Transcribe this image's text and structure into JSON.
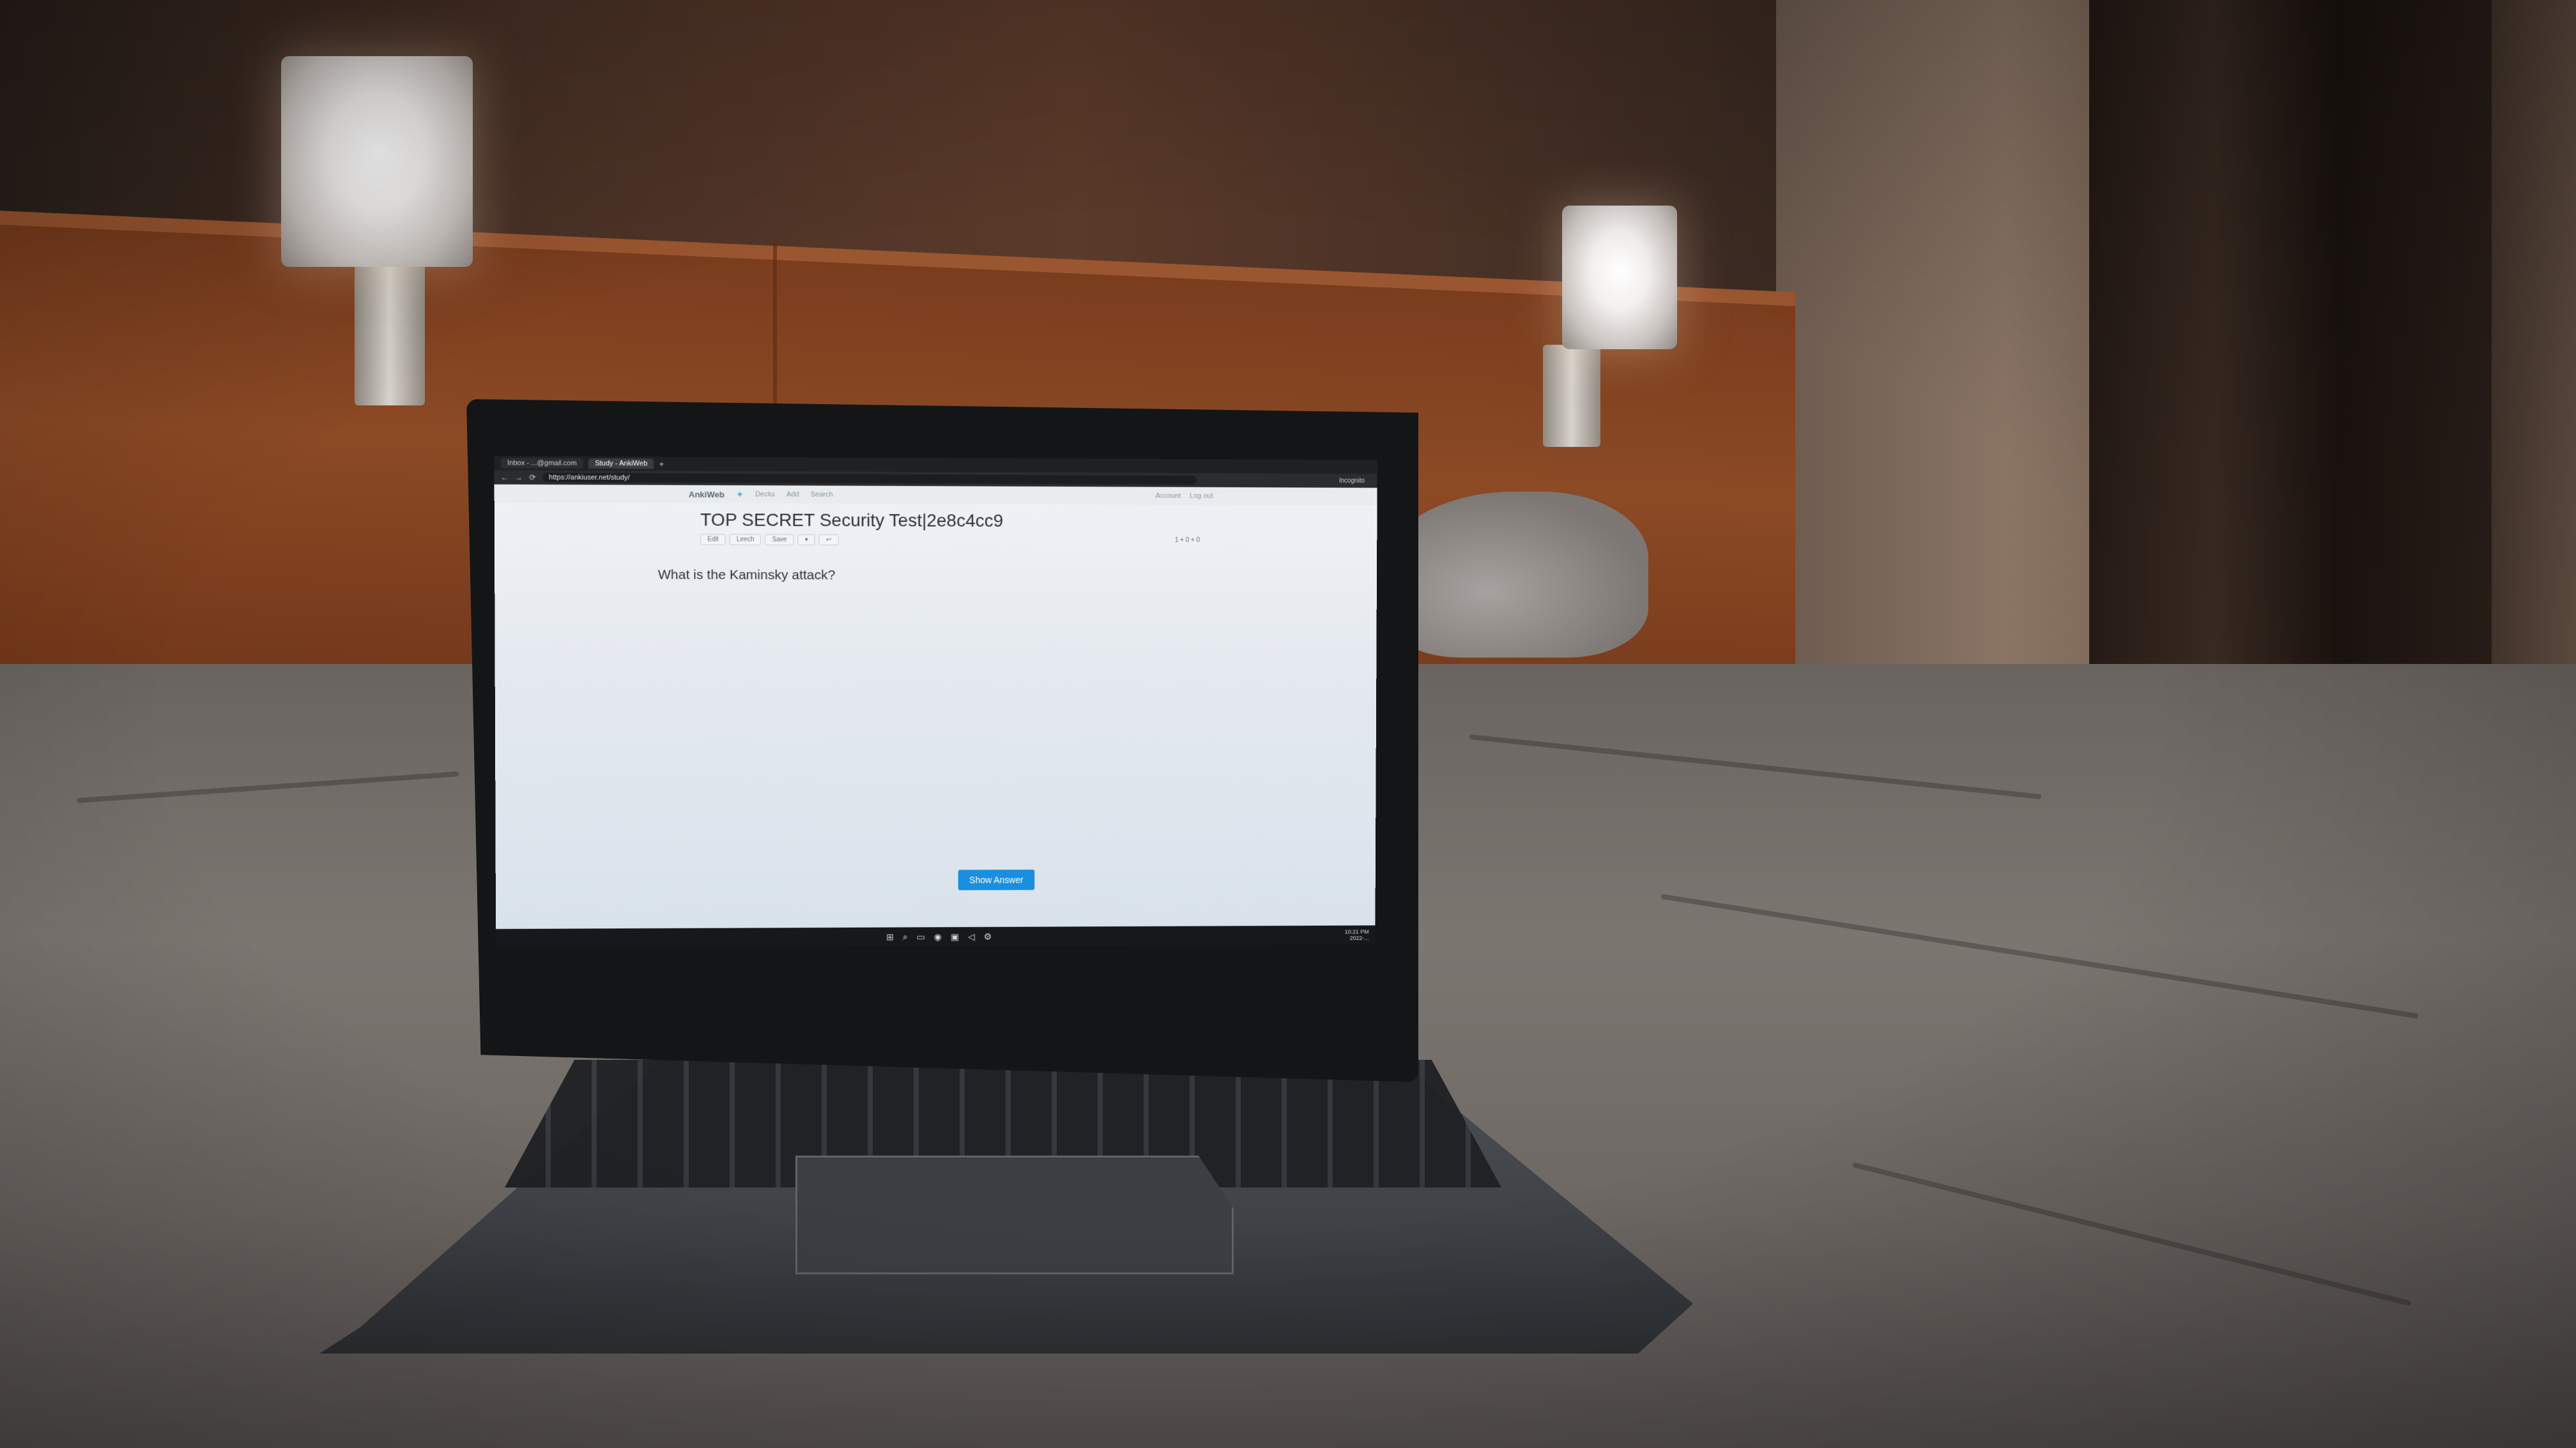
{
  "browser": {
    "tabs": [
      {
        "label": "Inbox - ...@gmail.com"
      },
      {
        "label": "Study - AnkiWeb"
      }
    ],
    "new_tab": "+",
    "url": "https://ankiuser.net/study/",
    "profile": "Incognito"
  },
  "anki": {
    "brand": "AnkiWeb",
    "nav_left": [
      "Decks",
      "Add",
      "Search"
    ],
    "nav_right": [
      "Account",
      "Log out"
    ],
    "deck_title": "TOP SECRET Security Test|2e8c4cc9",
    "toolbar": [
      "Edit",
      "Leech",
      "Save",
      "▾",
      "↩"
    ],
    "counts": "1 + 0 + 0",
    "question": "What is the Kaminsky attack?",
    "show_answer": "Show Answer"
  },
  "taskbar": {
    "icons": [
      "windows-start-icon",
      "search-icon",
      "files-icon",
      "browser-icon",
      "terminal-icon",
      "vscode-icon",
      "settings-icon"
    ],
    "time": "10:21 PM",
    "date": "2022-..."
  }
}
